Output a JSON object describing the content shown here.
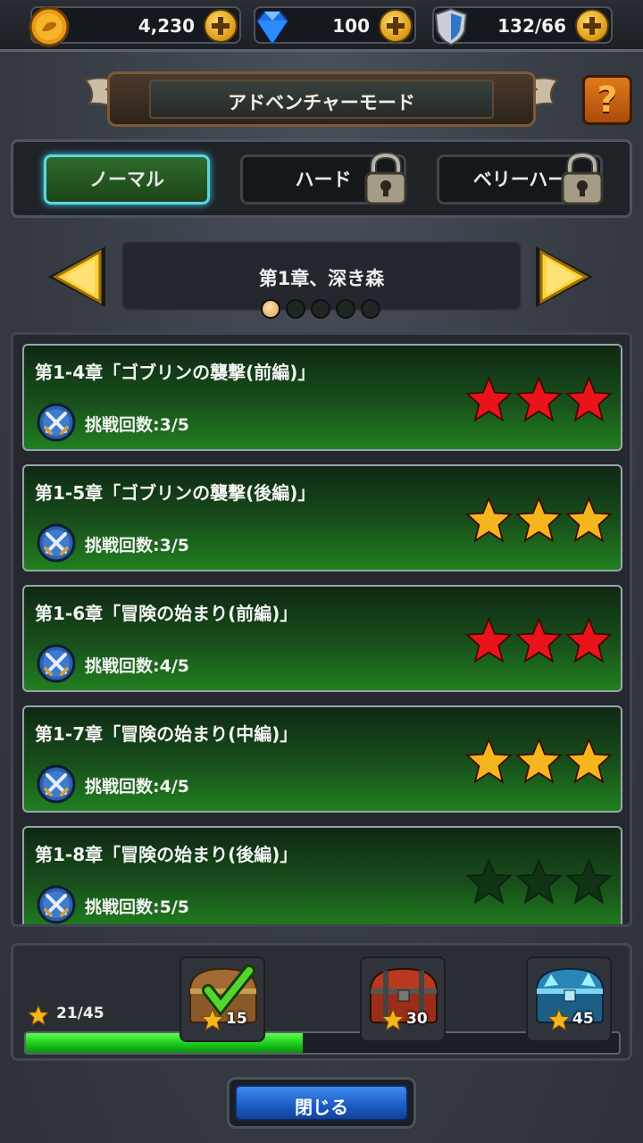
{
  "resources": {
    "gold": "4,230",
    "gems": "100",
    "stamina": "132/66"
  },
  "header": {
    "title": "アドベンチャーモード",
    "help_label": "?"
  },
  "tabs": [
    {
      "label": "ノーマル",
      "active": true,
      "locked": false
    },
    {
      "label": "ハード",
      "active": false,
      "locked": true
    },
    {
      "label": "ベリーハー",
      "active": false,
      "locked": true
    }
  ],
  "chapter": {
    "title": "第1章、深き森",
    "page_count": 5,
    "current_page": 1
  },
  "stages": [
    {
      "name": "第1-4章「ゴブリンの襲撃(前編)」",
      "tries": "挑戦回数:3/5",
      "star_color": "red"
    },
    {
      "name": "第1-5章「ゴブリンの襲撃(後編)」",
      "tries": "挑戦回数:3/5",
      "star_color": "gold"
    },
    {
      "name": "第1-6章「冒険の始まり(前編)」",
      "tries": "挑戦回数:4/5",
      "star_color": "red"
    },
    {
      "name": "第1-7章「冒険の始まり(中編)」",
      "tries": "挑戦回数:4/5",
      "star_color": "gold"
    },
    {
      "name": "第1-8章「冒険の始まり(後編)」",
      "tries": "挑戦回数:5/5",
      "star_color": "empty"
    }
  ],
  "rewards": {
    "star_progress": "21/45",
    "progress_fraction": 0.467,
    "chests": [
      {
        "count": "15",
        "claimed": true,
        "kind": "wood"
      },
      {
        "count": "30",
        "claimed": false,
        "kind": "red"
      },
      {
        "count": "45",
        "claimed": false,
        "kind": "blue"
      }
    ]
  },
  "close_label": "閉じる",
  "colors": {
    "star_red": "#e8141a",
    "star_gold": "#f5b51c",
    "star_empty": "#0f3314",
    "progress": "#2fe32a",
    "tab_active_border": "#5cd6e6"
  }
}
